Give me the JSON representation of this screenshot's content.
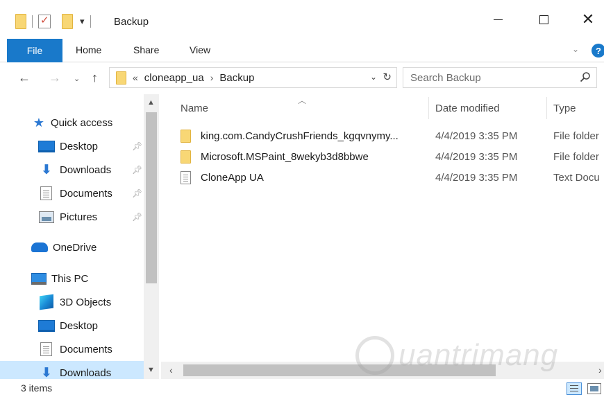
{
  "window": {
    "title": "Backup",
    "qat_dropdown": "▾"
  },
  "ribbon": {
    "file": "File",
    "home": "Home",
    "share": "Share",
    "view": "View",
    "help": "?"
  },
  "nav": {
    "back": "←",
    "forward": "→",
    "recent": "⌄",
    "up": "↑"
  },
  "address": {
    "overflow": "«",
    "crumbs": [
      "cloneapp_ua",
      "Backup"
    ],
    "separator": "›"
  },
  "search": {
    "placeholder": "Search Backup"
  },
  "navpane": {
    "quick_access": "Quick access",
    "desktop": "Desktop",
    "downloads": "Downloads",
    "documents": "Documents",
    "pictures": "Pictures",
    "onedrive": "OneDrive",
    "this_pc": "This PC",
    "objects3d": "3D Objects",
    "pc_desktop": "Desktop",
    "pc_documents": "Documents",
    "pc_downloads": "Downloads"
  },
  "columns": {
    "name": "Name",
    "date": "Date modified",
    "type": "Type"
  },
  "files": [
    {
      "name": "king.com.CandyCrushFriends_kgqvnymy...",
      "date": "4/4/2019 3:35 PM",
      "type": "File folder",
      "icon": "folder-icon"
    },
    {
      "name": "Microsoft.MSPaint_8wekyb3d8bbwe",
      "date": "4/4/2019 3:35 PM",
      "type": "File folder",
      "icon": "folder-icon"
    },
    {
      "name": "CloneApp UA",
      "date": "4/4/2019 3:35 PM",
      "type": "Text Docu",
      "icon": "text-file-icon"
    }
  ],
  "status": {
    "count": "3 items"
  },
  "colors": {
    "accent": "#1979ca",
    "folder": "#f8d775",
    "selection": "#cce8ff"
  }
}
